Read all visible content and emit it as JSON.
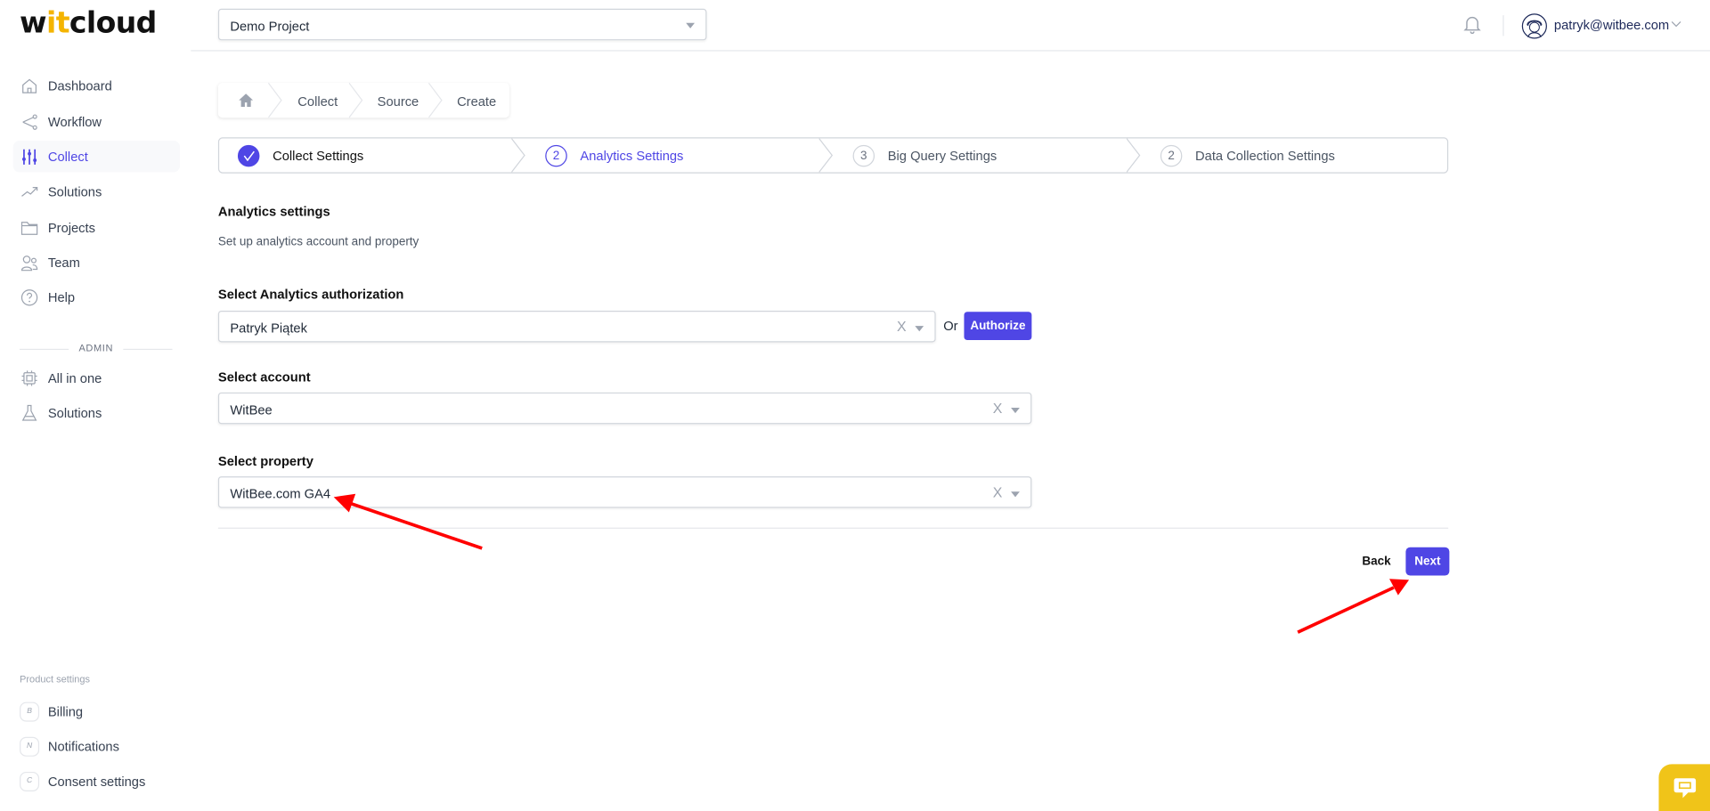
{
  "logo": {
    "part1": "w",
    "part2": "it",
    "part3": "cloud"
  },
  "header": {
    "project": "Demo Project",
    "user_email": "patryk@witbee.com"
  },
  "sidebar": {
    "items": [
      {
        "label": "Dashboard"
      },
      {
        "label": "Workflow"
      },
      {
        "label": "Collect"
      },
      {
        "label": "Solutions"
      },
      {
        "label": "Projects"
      },
      {
        "label": "Team"
      },
      {
        "label": "Help"
      }
    ],
    "admin_label": "ADMIN",
    "admin_items": [
      {
        "label": "All in one"
      },
      {
        "label": "Solutions"
      }
    ],
    "product_settings_label": "Product settings",
    "product_items": [
      {
        "badge": "B",
        "label": "Billing"
      },
      {
        "badge": "N",
        "label": "Notifications"
      },
      {
        "badge": "C",
        "label": "Consent settings"
      }
    ]
  },
  "breadcrumb": [
    "Collect",
    "Source",
    "Create"
  ],
  "stepper": [
    {
      "num": "",
      "label": "Collect Settings",
      "state": "done"
    },
    {
      "num": "2",
      "label": "Analytics Settings",
      "state": "active"
    },
    {
      "num": "3",
      "label": "Big Query Settings",
      "state": "pending"
    },
    {
      "num": "2",
      "label": "Data Collection Settings",
      "state": "pending"
    }
  ],
  "form": {
    "title": "Analytics settings",
    "subtitle": "Set up analytics account and property",
    "auth_label": "Select Analytics authorization",
    "auth_value": "Patryk Piątek",
    "or": "Or",
    "authorize": "Authorize",
    "account_label": "Select account",
    "account_value": "WitBee",
    "property_label": "Select property",
    "property_value": "WitBee.com GA4",
    "clear": "X",
    "back": "Back",
    "next": "Next"
  },
  "colors": {
    "accent": "#4f46e5",
    "chat": "#f0c419",
    "annotation": "#ff0000"
  }
}
